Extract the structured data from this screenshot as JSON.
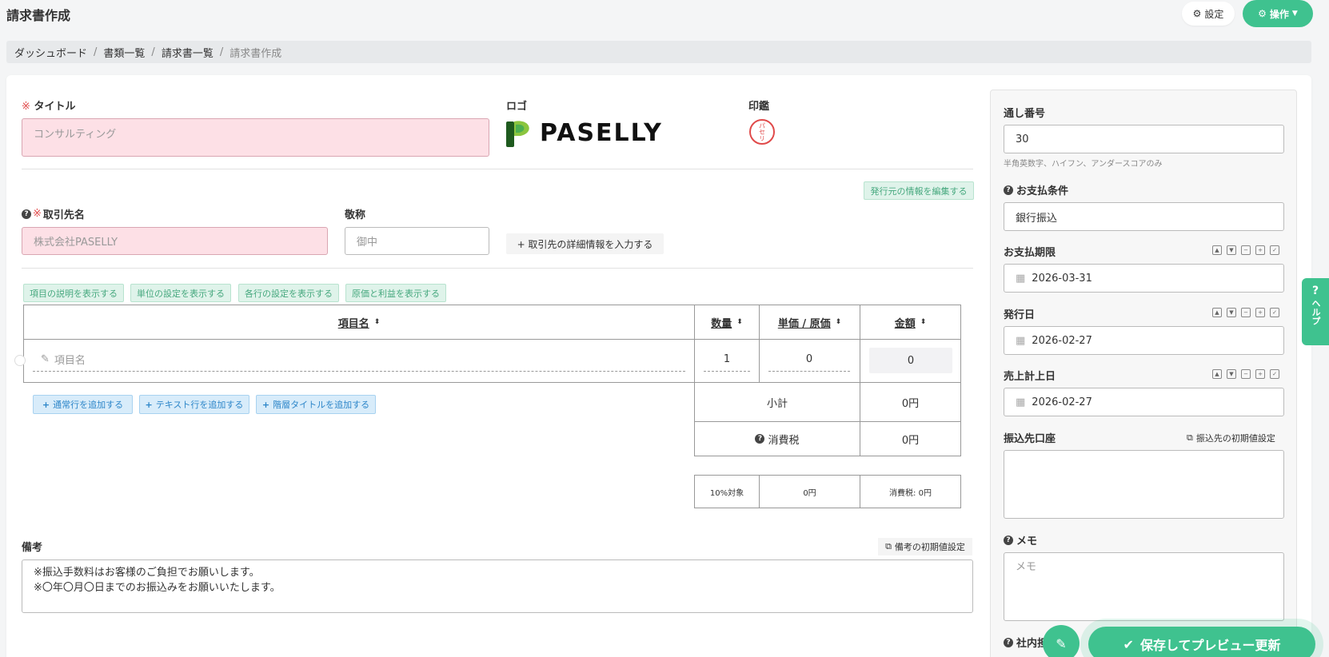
{
  "header": {
    "title": "請求書作成",
    "settings_label": "設定",
    "ops_label": "操作"
  },
  "breadcrumb": [
    "ダッシュボード",
    "書類一覧",
    "請求書一覧",
    "請求書作成"
  ],
  "form": {
    "title_label": "タイトル",
    "title_mark": "※",
    "title_placeholder": "コンサルティング",
    "logo_label": "ロゴ",
    "logo_text": "PASELLY",
    "seal_label": "印鑑",
    "seal_text": "パセリ",
    "edit_issuer_label": "発行元の情報を編集する",
    "client_label": "取引先名",
    "client_mark": "※",
    "client_placeholder": "株式会社PASELLY",
    "honorific_label": "敬称",
    "honorific_placeholder": "御中",
    "client_detail_label": "+ 取引先の詳細情報を入力する",
    "toggles": [
      "項目の説明を表示する",
      "単位の設定を表示する",
      "各行の設定を表示する",
      "原価と利益を表示する"
    ],
    "table": {
      "headers": {
        "item": "項目名",
        "qty": "数量",
        "unit_price": "単価 / 原価",
        "amount": "金額"
      },
      "row": {
        "item_placeholder": "項目名",
        "qty": "1",
        "unit_price": "0",
        "amount": "0"
      },
      "subtotal_label": "小計",
      "subtotal_value": "0円",
      "tax_label": "消費税",
      "tax_value": "0円",
      "tax_breakdown": {
        "rate": "10%対象",
        "base": "0円",
        "tax": "消費税: 0円"
      }
    },
    "add_buttons": [
      "通常行を追加する",
      "テキスト行を追加する",
      "階層タイトルを追加する"
    ],
    "remarks_label": "備考",
    "remarks_default_label": "備考の初期値設定",
    "remarks_lines": [
      "※振込手数料はお客様のご負担でお願いします。",
      "※〇年〇月〇日までのお振込みをお願いいたします。"
    ]
  },
  "side": {
    "serial_label": "通し番号",
    "serial_value": "30",
    "serial_hint": "半角英数字、ハイフン、アンダースコアのみ",
    "payment_terms_label": "お支払条件",
    "payment_terms_value": "銀行振込",
    "due_label": "お支払期限",
    "due_value": "2026-03-31",
    "issue_label": "発行日",
    "issue_value": "2026-02-27",
    "sales_label": "売上計上日",
    "sales_value": "2026-02-27",
    "bank_label": "振込先口座",
    "bank_default_label": "振込先の初期値設定",
    "memo_label": "メモ",
    "memo_placeholder": "メモ",
    "internal_label": "社内担"
  },
  "help_tab": {
    "q": "?",
    "label": "ヘルプ"
  },
  "save_label": "保存してプレビュー更新",
  "colors": {
    "accent": "#3fc28f",
    "pink": "#fde0e6",
    "required": "#e04a4a"
  }
}
